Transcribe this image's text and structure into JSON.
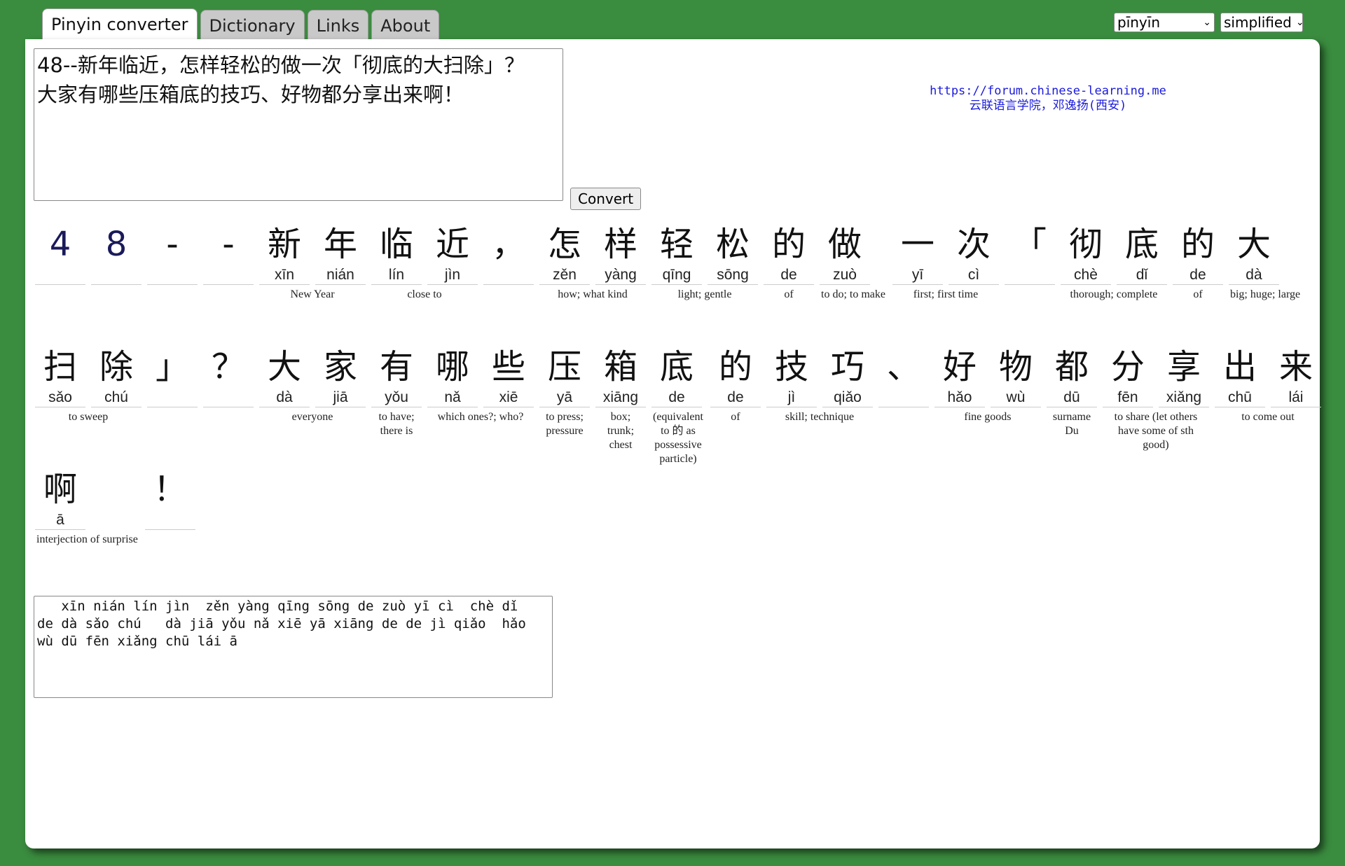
{
  "tabs": [
    "Pinyin converter",
    "Dictionary",
    "Links",
    "About"
  ],
  "selects": {
    "mode": "pīnyīn",
    "script": "simplified"
  },
  "input_text": "48--新年临近，怎样轻松的做一次「彻底的大扫除」？\n大家有哪些压箱底的技巧、好物都分享出来啊！",
  "convert_label": "Convert",
  "credit": {
    "url": "https://forum.chinese-learning.me",
    "name": "云联语言学院，邓逸扬(西安)"
  },
  "rows": [
    [
      {
        "chars": [
          {
            "hz": "4",
            "py": "",
            "d": true
          }
        ],
        "gloss": ""
      },
      {
        "chars": [
          {
            "hz": "8",
            "py": "",
            "d": true
          }
        ],
        "gloss": ""
      },
      {
        "chars": [
          {
            "hz": "-",
            "py": ""
          }
        ],
        "gloss": ""
      },
      {
        "chars": [
          {
            "hz": "-",
            "py": ""
          }
        ],
        "gloss": ""
      },
      {
        "chars": [
          {
            "hz": "新",
            "py": "xīn"
          },
          {
            "hz": "年",
            "py": "nián"
          }
        ],
        "gloss": "New Year"
      },
      {
        "chars": [
          {
            "hz": "临",
            "py": "lín"
          },
          {
            "hz": "近",
            "py": "jìn"
          }
        ],
        "gloss": "close to"
      },
      {
        "chars": [
          {
            "hz": "，",
            "py": ""
          }
        ],
        "gloss": ""
      },
      {
        "chars": [
          {
            "hz": "怎",
            "py": "zěn"
          },
          {
            "hz": "样",
            "py": "yàng"
          }
        ],
        "gloss": "how; what kind"
      },
      {
        "chars": [
          {
            "hz": "轻",
            "py": "qīng"
          },
          {
            "hz": "松",
            "py": "sōng"
          }
        ],
        "gloss": "light; gentle"
      },
      {
        "chars": [
          {
            "hz": "的",
            "py": "de"
          }
        ],
        "gloss": "of"
      },
      {
        "chars": [
          {
            "hz": "做",
            "py": "zuò"
          }
        ],
        "gloss": "to do; to make"
      },
      {
        "chars": [
          {
            "hz": "一",
            "py": "yī"
          },
          {
            "hz": "次",
            "py": "cì"
          }
        ],
        "gloss": "first; first time"
      },
      {
        "chars": [
          {
            "hz": "「",
            "py": ""
          }
        ],
        "gloss": ""
      },
      {
        "chars": [
          {
            "hz": "彻",
            "py": "chè"
          },
          {
            "hz": "底",
            "py": "dǐ"
          }
        ],
        "gloss": "thorough; complete"
      },
      {
        "chars": [
          {
            "hz": "的",
            "py": "de"
          }
        ],
        "gloss": "of"
      },
      {
        "chars": [
          {
            "hz": "大",
            "py": "dà"
          }
        ],
        "gloss": "big; huge; large"
      }
    ],
    [
      {
        "chars": [
          {
            "hz": "扫",
            "py": "sǎo"
          },
          {
            "hz": "除",
            "py": "chú"
          }
        ],
        "gloss": "to sweep"
      },
      {
        "chars": [
          {
            "hz": "」",
            "py": ""
          }
        ],
        "gloss": ""
      },
      {
        "chars": [
          {
            "hz": "？",
            "py": ""
          }
        ],
        "gloss": ""
      },
      {
        "chars": [
          {
            "hz": "大",
            "py": "dà"
          },
          {
            "hz": "家",
            "py": "jiā"
          }
        ],
        "gloss": "everyone"
      },
      {
        "chars": [
          {
            "hz": "有",
            "py": "yǒu"
          }
        ],
        "gloss": "to have; there is"
      },
      {
        "chars": [
          {
            "hz": "哪",
            "py": "nǎ"
          },
          {
            "hz": "些",
            "py": "xiē"
          }
        ],
        "gloss": "which ones?; who?"
      },
      {
        "chars": [
          {
            "hz": "压",
            "py": "yā"
          }
        ],
        "gloss": "to press; pressure"
      },
      {
        "chars": [
          {
            "hz": "箱",
            "py": "xiāng"
          }
        ],
        "gloss": "box; trunk; chest"
      },
      {
        "chars": [
          {
            "hz": "底",
            "py": "de"
          }
        ],
        "gloss": "(equivalent to 的 as possessive particle)"
      },
      {
        "chars": [
          {
            "hz": "的",
            "py": "de"
          }
        ],
        "gloss": "of"
      },
      {
        "chars": [
          {
            "hz": "技",
            "py": "jì"
          },
          {
            "hz": "巧",
            "py": "qiǎo"
          }
        ],
        "gloss": "skill; technique"
      },
      {
        "chars": [
          {
            "hz": "、",
            "py": ""
          }
        ],
        "gloss": ""
      },
      {
        "chars": [
          {
            "hz": "好",
            "py": "hǎo"
          },
          {
            "hz": "物",
            "py": "wù"
          }
        ],
        "gloss": "fine goods"
      },
      {
        "chars": [
          {
            "hz": "都",
            "py": "dū"
          }
        ],
        "gloss": "surname Du"
      },
      {
        "chars": [
          {
            "hz": "分",
            "py": "fēn"
          },
          {
            "hz": "享",
            "py": "xiǎng"
          }
        ],
        "gloss": "to share (let others have some of sth good)"
      },
      {
        "chars": [
          {
            "hz": "出",
            "py": "chū"
          },
          {
            "hz": "来",
            "py": "lái"
          }
        ],
        "gloss": "to come out"
      }
    ],
    [
      {
        "chars": [
          {
            "hz": "啊",
            "py": "ā"
          }
        ],
        "gloss": "interjection of surprise"
      },
      {
        "chars": [
          {
            "hz": "！",
            "py": ""
          }
        ],
        "gloss": ""
      }
    ]
  ],
  "output_text": "   xīn nián lín jìn  zěn yàng qīng sōng de zuò yī cì  chè dǐ\nde dà sǎo chú   dà jiā yǒu nǎ xiē yā xiāng de de jì qiǎo  hǎo\nwù dū fēn xiǎng chū lái ā"
}
